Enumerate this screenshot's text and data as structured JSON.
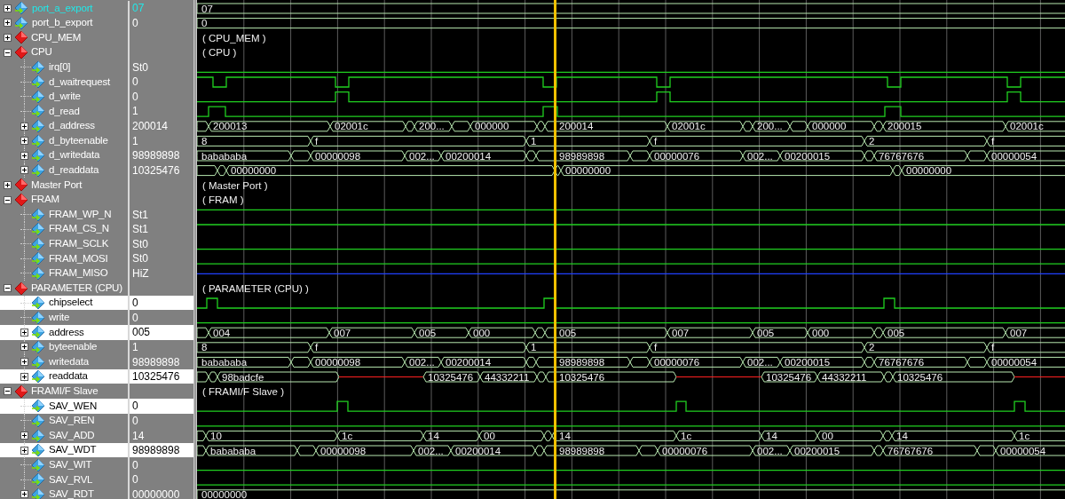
{
  "signals": [
    {
      "kind": "bus",
      "name": "port_a_export",
      "value": "07",
      "active": true,
      "selected": false,
      "expanded": false,
      "wave": [
        {
          "kind": "data",
          "text": "07"
        }
      ]
    },
    {
      "kind": "bus",
      "name": "port_b_export",
      "value": "0",
      "active": false,
      "selected": false,
      "expanded": false,
      "wave": [
        {
          "kind": "data",
          "text": "0"
        }
      ]
    },
    {
      "kind": "group",
      "name": "CPU_MEM",
      "expanded": false,
      "wave_label": "( CPU_MEM )"
    },
    {
      "kind": "group",
      "name": "CPU",
      "expanded": true,
      "wave_label": "( CPU )",
      "children": [
        {
          "kind": "bit",
          "name": "irq[0]",
          "value": "St0",
          "active": false,
          "selected": false
        },
        {
          "kind": "bit",
          "name": "d_waitrequest",
          "value": "0",
          "active": false,
          "selected": false
        },
        {
          "kind": "bit",
          "name": "d_write",
          "value": "0",
          "active": false,
          "selected": false
        },
        {
          "kind": "bit",
          "name": "d_read",
          "value": "1",
          "active": false,
          "selected": false
        },
        {
          "kind": "bus",
          "name": "d_address",
          "value": "200014",
          "active": false,
          "selected": false,
          "expanded": false,
          "wave": [
            {
              "kind": "data"
            },
            {
              "kind": "data",
              "text": "200013"
            },
            {
              "kind": "data",
              "text": "02001c"
            },
            {
              "kind": "data"
            },
            {
              "kind": "data",
              "text": "200..."
            },
            {
              "kind": "data"
            },
            {
              "kind": "data",
              "text": "000000"
            },
            {
              "kind": "data"
            },
            {
              "kind": "data",
              "text": "200014"
            },
            {
              "kind": "data",
              "text": "02001c"
            },
            {
              "kind": "data"
            },
            {
              "kind": "data",
              "text": "200..."
            },
            {
              "kind": "data"
            },
            {
              "kind": "data",
              "text": "000000"
            },
            {
              "kind": "data"
            },
            {
              "kind": "data",
              "text": "200015"
            },
            {
              "kind": "data",
              "text": "02001c"
            }
          ]
        },
        {
          "kind": "bus",
          "name": "d_byteenable",
          "value": "1",
          "active": false,
          "selected": false,
          "expanded": false,
          "wave": [
            {
              "kind": "data",
              "text": "8"
            },
            {
              "kind": "data",
              "text": "f"
            },
            {
              "kind": "data",
              "text": "1"
            },
            {
              "kind": "data",
              "text": "f"
            },
            {
              "kind": "data",
              "text": "2"
            },
            {
              "kind": "data",
              "text": "f"
            }
          ]
        },
        {
          "kind": "bus",
          "name": "d_writedata",
          "value": "98989898",
          "active": false,
          "selected": false,
          "expanded": false,
          "wave": [
            {
              "kind": "data",
              "text": "babababa"
            },
            {
              "kind": "data"
            },
            {
              "kind": "data",
              "text": "00000098"
            },
            {
              "kind": "data",
              "text": "002..."
            },
            {
              "kind": "data",
              "text": "00200014"
            },
            {
              "kind": "data"
            },
            {
              "kind": "data",
              "text": "98989898"
            },
            {
              "kind": "data"
            },
            {
              "kind": "data",
              "text": "00000076"
            },
            {
              "kind": "data",
              "text": "002..."
            },
            {
              "kind": "data",
              "text": "00200015"
            },
            {
              "kind": "data"
            },
            {
              "kind": "data",
              "text": "76767676"
            },
            {
              "kind": "data"
            },
            {
              "kind": "data",
              "text": "00000054"
            }
          ]
        },
        {
          "kind": "bus",
          "name": "d_readdata",
          "value": "10325476",
          "active": false,
          "selected": false,
          "expanded": false,
          "wave": [
            {
              "kind": "data"
            },
            {
              "kind": "data"
            },
            {
              "kind": "data",
              "text": "00000000"
            },
            {
              "kind": "data"
            },
            {
              "kind": "data",
              "text": "00000000"
            },
            {
              "kind": "data"
            },
            {
              "kind": "data",
              "text": "00000000"
            }
          ]
        }
      ]
    },
    {
      "kind": "group",
      "name": "Master Port",
      "expanded": false,
      "wave_label": "( Master Port )"
    },
    {
      "kind": "group",
      "name": "FRAM",
      "expanded": true,
      "wave_label": "( FRAM )",
      "children": [
        {
          "kind": "bit",
          "name": "FRAM_WP_N",
          "value": "St1",
          "active": false,
          "selected": false
        },
        {
          "kind": "bit",
          "name": "FRAM_CS_N",
          "value": "St1",
          "active": false,
          "selected": false
        },
        {
          "kind": "bit",
          "name": "FRAM_SCLK",
          "value": "St0",
          "active": false,
          "selected": false
        },
        {
          "kind": "bit",
          "name": "FRAM_MOSI",
          "value": "St0",
          "active": false,
          "selected": false
        },
        {
          "kind": "bit",
          "name": "FRAM_MISO",
          "value": "HiZ",
          "active": false,
          "selected": false
        }
      ]
    },
    {
      "kind": "group",
      "name": "PARAMETER (CPU)",
      "expanded": true,
      "wave_label": "( PARAMETER (CPU) )",
      "children": [
        {
          "kind": "bit",
          "name": "chipselect",
          "value": "0",
          "active": false,
          "selected": true
        },
        {
          "kind": "bit",
          "name": "write",
          "value": "0",
          "active": false,
          "selected": false
        },
        {
          "kind": "bus",
          "name": "address",
          "value": "005",
          "active": false,
          "selected": true,
          "expanded": false,
          "wave": [
            {
              "kind": "data"
            },
            {
              "kind": "data",
              "text": "004"
            },
            {
              "kind": "data",
              "text": "007"
            },
            {
              "kind": "data",
              "text": "005"
            },
            {
              "kind": "data",
              "text": "000"
            },
            {
              "kind": "data"
            },
            {
              "kind": "data",
              "text": "005"
            },
            {
              "kind": "data",
              "text": "007"
            },
            {
              "kind": "data",
              "text": "005"
            },
            {
              "kind": "data",
              "text": "000"
            },
            {
              "kind": "data"
            },
            {
              "kind": "data",
              "text": "005"
            },
            {
              "kind": "data",
              "text": "007"
            }
          ]
        },
        {
          "kind": "bus",
          "name": "byteenable",
          "value": "1",
          "active": false,
          "selected": false,
          "expanded": false,
          "wave": [
            {
              "kind": "data",
              "text": "8"
            },
            {
              "kind": "data",
              "text": "f"
            },
            {
              "kind": "data",
              "text": "1"
            },
            {
              "kind": "data",
              "text": "f"
            },
            {
              "kind": "data",
              "text": "2"
            },
            {
              "kind": "data",
              "text": "f"
            }
          ]
        },
        {
          "kind": "bus",
          "name": "writedata",
          "value": "98989898",
          "active": false,
          "selected": false,
          "expanded": false,
          "wave": [
            {
              "kind": "data",
              "text": "babababa"
            },
            {
              "kind": "data"
            },
            {
              "kind": "data",
              "text": "00000098"
            },
            {
              "kind": "data",
              "text": "002..."
            },
            {
              "kind": "data",
              "text": "00200014"
            },
            {
              "kind": "data"
            },
            {
              "kind": "data",
              "text": "98989898"
            },
            {
              "kind": "data"
            },
            {
              "kind": "data",
              "text": "00000076"
            },
            {
              "kind": "data",
              "text": "002..."
            },
            {
              "kind": "data",
              "text": "00200015"
            },
            {
              "kind": "data"
            },
            {
              "kind": "data",
              "text": "76767676"
            },
            {
              "kind": "data"
            },
            {
              "kind": "data",
              "text": "00000054"
            }
          ]
        },
        {
          "kind": "bus",
          "name": "readdata",
          "value": "10325476",
          "active": false,
          "selected": true,
          "expanded": false,
          "wave": [
            {
              "kind": "data"
            },
            {
              "kind": "data"
            },
            {
              "kind": "data",
              "text": "98badcfe"
            },
            {
              "kind": "z"
            },
            {
              "kind": "data",
              "text": "10325476"
            },
            {
              "kind": "data",
              "text": "44332211"
            },
            {
              "kind": "data"
            },
            {
              "kind": "data",
              "text": "10325476"
            },
            {
              "kind": "z"
            },
            {
              "kind": "data",
              "text": "10325476"
            },
            {
              "kind": "data",
              "text": "44332211"
            },
            {
              "kind": "data"
            },
            {
              "kind": "data",
              "text": "10325476"
            },
            {
              "kind": "z"
            }
          ]
        }
      ]
    },
    {
      "kind": "group",
      "name": "FRAMI/F Slave",
      "expanded": true,
      "wave_label": "( FRAMI/F Slave )",
      "children": [
        {
          "kind": "bit",
          "name": "SAV_WEN",
          "value": "0",
          "active": false,
          "selected": true
        },
        {
          "kind": "bit",
          "name": "SAV_REN",
          "value": "0",
          "active": false,
          "selected": false
        },
        {
          "kind": "bus",
          "name": "SAV_ADD",
          "value": "14",
          "active": false,
          "selected": false,
          "expanded": false,
          "wave": [
            {
              "kind": "data"
            },
            {
              "kind": "data",
              "text": "10"
            },
            {
              "kind": "data",
              "text": "1c"
            },
            {
              "kind": "data",
              "text": "14"
            },
            {
              "kind": "data",
              "text": "00"
            },
            {
              "kind": "data"
            },
            {
              "kind": "data",
              "text": "14"
            },
            {
              "kind": "data",
              "text": "1c"
            },
            {
              "kind": "data",
              "text": "14"
            },
            {
              "kind": "data",
              "text": "00"
            },
            {
              "kind": "data"
            },
            {
              "kind": "data",
              "text": "14"
            },
            {
              "kind": "data",
              "text": "1c"
            }
          ]
        },
        {
          "kind": "bus",
          "name": "SAV_WDT",
          "value": "98989898",
          "active": false,
          "selected": true,
          "expanded": false,
          "wave": [
            {
              "kind": "data"
            },
            {
              "kind": "data",
              "text": "babababa"
            },
            {
              "kind": "data"
            },
            {
              "kind": "data",
              "text": "00000098"
            },
            {
              "kind": "data",
              "text": "002..."
            },
            {
              "kind": "data",
              "text": "00200014"
            },
            {
              "kind": "data"
            },
            {
              "kind": "data",
              "text": "98989898"
            },
            {
              "kind": "data"
            },
            {
              "kind": "data",
              "text": "00000076"
            },
            {
              "kind": "data",
              "text": "002..."
            },
            {
              "kind": "data",
              "text": "00200015"
            },
            {
              "kind": "data"
            },
            {
              "kind": "data",
              "text": "76767676"
            },
            {
              "kind": "data"
            },
            {
              "kind": "data",
              "text": "00000054"
            }
          ]
        },
        {
          "kind": "bit",
          "name": "SAV_WIT",
          "value": "0",
          "active": false,
          "selected": false
        },
        {
          "kind": "bit",
          "name": "SAV_RVL",
          "value": "0",
          "active": false,
          "selected": false
        },
        {
          "kind": "bus",
          "name": "SAV_RDT",
          "value": "00000000",
          "active": false,
          "selected": false,
          "expanded": false,
          "wave": [
            {
              "kind": "data",
              "text": "00000000"
            }
          ]
        }
      ]
    }
  ]
}
